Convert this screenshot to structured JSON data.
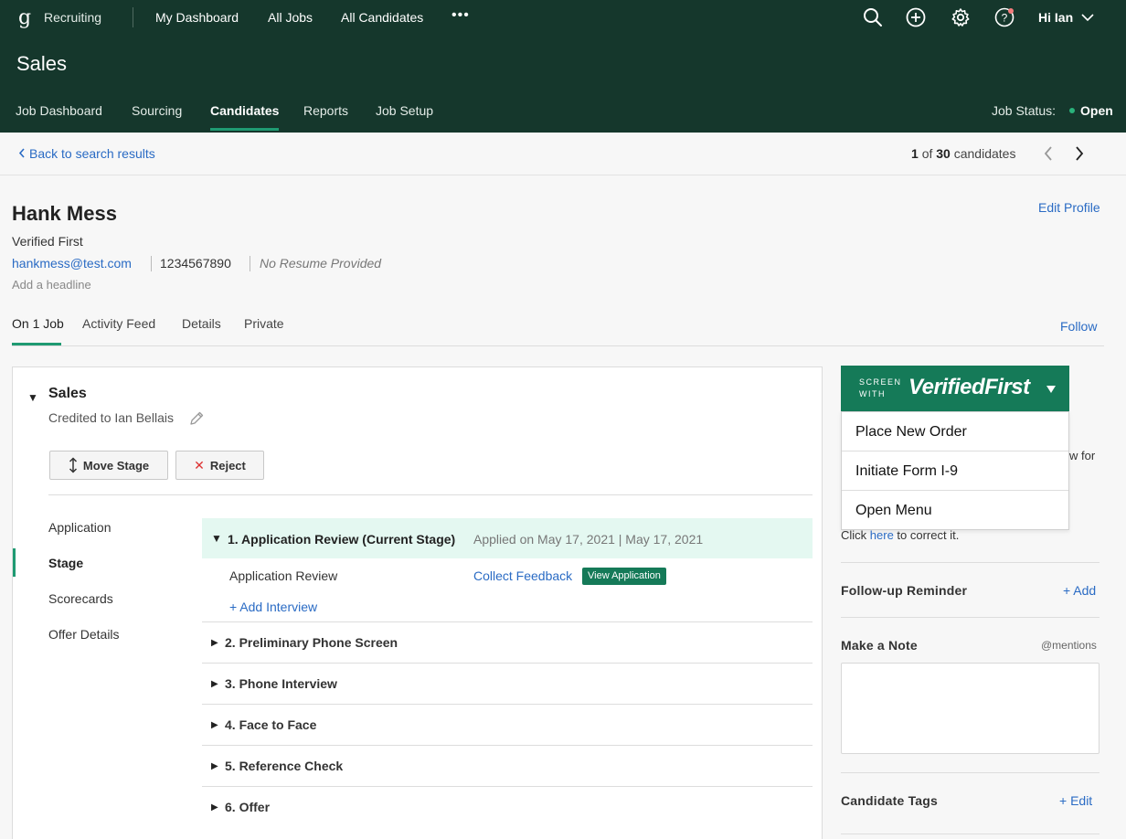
{
  "topnav": {
    "logo": "g",
    "app_name": "Recruiting",
    "links": [
      "My Dashboard",
      "All Jobs",
      "All Candidates"
    ],
    "more": "•••",
    "greeting": "Hi Ian"
  },
  "job": {
    "title": "Sales",
    "tabs": [
      "Job Dashboard",
      "Sourcing",
      "Candidates",
      "Reports",
      "Job Setup"
    ],
    "status_label": "Job Status:",
    "status_value": "Open"
  },
  "breadcrumb": {
    "back": "Back to search results",
    "current": "1",
    "of": "of",
    "total": "30",
    "unit": "candidates"
  },
  "candidate": {
    "name": "Hank Mess",
    "edit_profile": "Edit Profile",
    "source": "Verified First",
    "email": "hankmess@test.com",
    "phone": "1234567890",
    "resume": "No Resume Provided",
    "headline_placeholder": "Add a headline",
    "tabs": [
      "On 1 Job",
      "Activity Feed",
      "Details",
      "Private"
    ],
    "follow": "Follow"
  },
  "application": {
    "job": "Sales",
    "credited": "Credited to Ian Bellais",
    "move_stage": "Move Stage",
    "reject": "Reject",
    "side_nav": [
      "Application",
      "Stage",
      "Scorecards",
      "Offer Details"
    ],
    "current_stage": {
      "title": "1.  Application Review (Current Stage)",
      "applied": "Applied on May 17, 2021 | May 17, 2021",
      "sub_name": "Application Review",
      "collect": "Collect Feedback",
      "view": "View Application",
      "add_interview": "+ Add Interview"
    },
    "stages": [
      "2.  Preliminary Phone Screen",
      "3.  Phone Interview",
      "4.  Face to Face",
      "5.  Reference Check",
      "6.  Offer"
    ]
  },
  "verified_first": {
    "screen_with_line1": "SCREEN",
    "screen_with_line2": "WITH",
    "brand": "VerifiedFirst",
    "menu": [
      "Place New Order",
      "Initiate Form I-9",
      "Open Menu"
    ],
    "obscured_text": "w for",
    "click_prefix": "Click ",
    "click_link": "here",
    "click_suffix": " to correct it."
  },
  "sidebar": {
    "followup_title": "Follow-up Reminder",
    "followup_add": "+ Add",
    "note_title": "Make a Note",
    "mentions": "@mentions",
    "tags_title": "Candidate Tags",
    "tags_edit": "+ Edit"
  },
  "colors": {
    "header_bg": "#15372c",
    "accent": "#1f9a72",
    "link": "#2a6bc4",
    "verified_first": "#157a58",
    "current_stage_bg": "#e4f8f1"
  }
}
